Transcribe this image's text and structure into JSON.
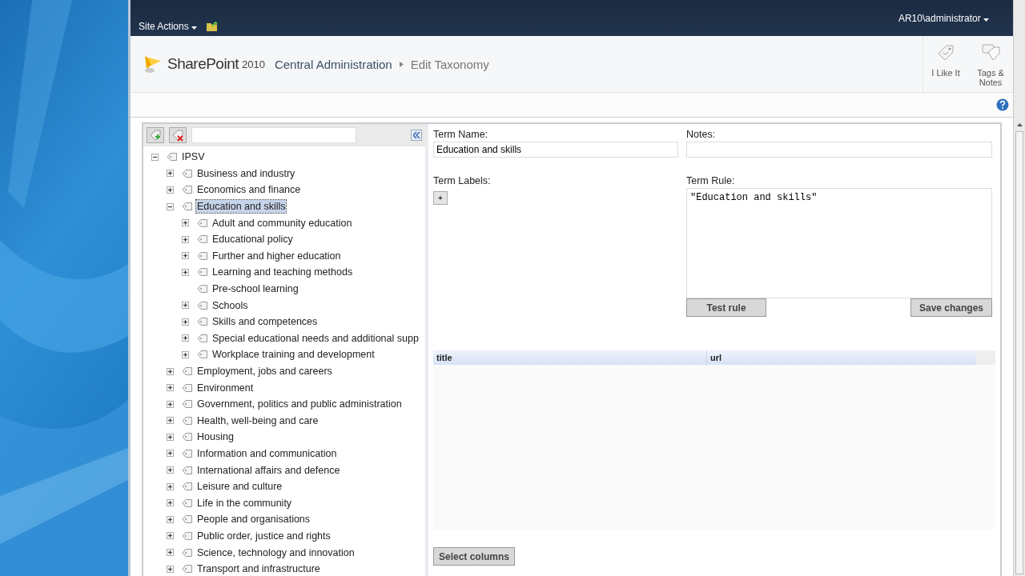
{
  "top_bar": {
    "site_actions": "Site Actions",
    "user": "AR10\\administrator"
  },
  "header": {
    "logo_brand": "SharePoint",
    "logo_version": "2010",
    "breadcrumb": [
      "Central Administration",
      "Edit Taxonomy"
    ],
    "social": [
      "I Like It",
      "Tags & Notes"
    ]
  },
  "tree": {
    "label": "IPSV",
    "expanded": true,
    "selected": false,
    "children": [
      {
        "label": "Business and industry",
        "expanded": false,
        "selected": false
      },
      {
        "label": "Economics and finance",
        "expanded": false,
        "selected": false
      },
      {
        "label": "Education and skills",
        "expanded": true,
        "selected": true,
        "children": [
          {
            "label": "Adult and community education",
            "expanded": false,
            "selected": false
          },
          {
            "label": "Educational policy",
            "expanded": false,
            "selected": false
          },
          {
            "label": "Further and higher education",
            "expanded": false,
            "selected": false
          },
          {
            "label": "Learning and teaching methods",
            "expanded": false,
            "selected": false
          },
          {
            "label": "Pre-school learning",
            "selected": false
          },
          {
            "label": "Schools",
            "expanded": false,
            "selected": false
          },
          {
            "label": "Skills and competences",
            "expanded": false,
            "selected": false
          },
          {
            "label": "Special educational needs and additional supp",
            "expanded": false,
            "selected": false
          },
          {
            "label": "Workplace training and development",
            "expanded": false,
            "selected": false
          }
        ]
      },
      {
        "label": "Employment, jobs and careers",
        "expanded": false,
        "selected": false
      },
      {
        "label": "Environment",
        "expanded": false,
        "selected": false
      },
      {
        "label": "Government, politics and public administration",
        "expanded": false,
        "selected": false
      },
      {
        "label": "Health, well-being and care",
        "expanded": false,
        "selected": false
      },
      {
        "label": "Housing",
        "expanded": false,
        "selected": false
      },
      {
        "label": "Information and communication",
        "expanded": false,
        "selected": false
      },
      {
        "label": "International affairs and defence",
        "expanded": false,
        "selected": false
      },
      {
        "label": "Leisure and culture",
        "expanded": false,
        "selected": false
      },
      {
        "label": "Life in the community",
        "expanded": false,
        "selected": false
      },
      {
        "label": "People and organisations",
        "expanded": false,
        "selected": false
      },
      {
        "label": "Public order, justice and rights",
        "expanded": false,
        "selected": false
      },
      {
        "label": "Science, technology and innovation",
        "expanded": false,
        "selected": false
      },
      {
        "label": "Transport and infrastructure",
        "expanded": false,
        "selected": false
      }
    ]
  },
  "editor": {
    "term_name_label": "Term Name:",
    "term_name": "Education and skills",
    "notes_label": "Notes:",
    "term_labels_label": "Term Labels:",
    "add_label_button": "+",
    "term_rule_label": "Term Rule:",
    "term_rule": "\"Education and skills\"",
    "test_button": "Test rule",
    "save_button": "Save changes"
  },
  "table": {
    "columns": [
      "title",
      "url"
    ]
  },
  "select_columns_button": "Select columns"
}
